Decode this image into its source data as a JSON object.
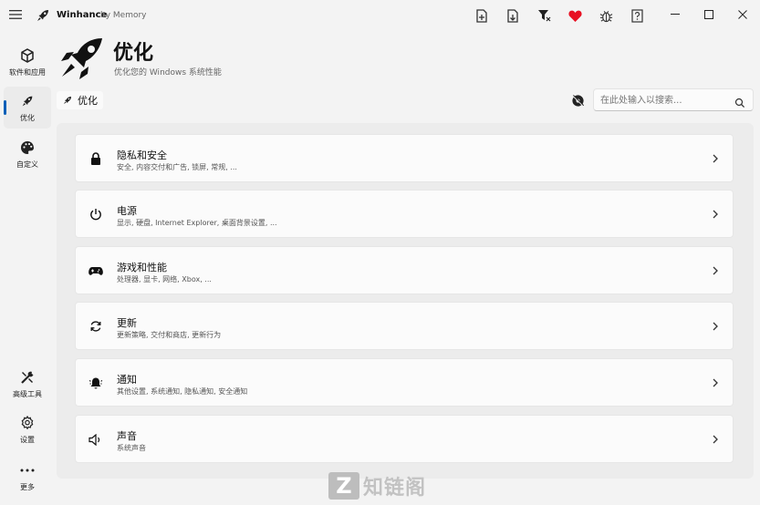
{
  "app": {
    "name": "Winhance",
    "subtitle": "by Memory"
  },
  "sidebar": {
    "items": [
      {
        "label": "软件和应用",
        "icon": "package-icon"
      },
      {
        "label": "优化",
        "icon": "rocket-icon",
        "active": true
      },
      {
        "label": "自定义",
        "icon": "palette-icon"
      },
      {
        "label": "高级工具",
        "icon": "tools-icon"
      },
      {
        "label": "设置",
        "icon": "gear-icon"
      },
      {
        "label": "更多",
        "icon": "more-icon"
      }
    ]
  },
  "header": {
    "title": "优化",
    "subtitle": "优化您的 Windows 系统性能"
  },
  "breadcrumb": {
    "label": "优化"
  },
  "search": {
    "placeholder": "在此处输入以搜索..."
  },
  "cards": [
    {
      "title": "隐私和安全",
      "desc": "安全, 内容交付和广告, 锁屏, 常规, ...",
      "icon": "lock-icon"
    },
    {
      "title": "电源",
      "desc": "显示, 硬盘, Internet Explorer, 桌面背景设置, ...",
      "icon": "power-icon"
    },
    {
      "title": "游戏和性能",
      "desc": "处理器, 显卡, 网络, Xbox, ...",
      "icon": "gamepad-icon"
    },
    {
      "title": "更新",
      "desc": "更新策略, 交付和商店, 更新行为",
      "icon": "refresh-icon"
    },
    {
      "title": "通知",
      "desc": "其他设置, 系统通知, 隐私通知, 安全通知",
      "icon": "bell-icon"
    },
    {
      "title": "声音",
      "desc": "系统声音",
      "icon": "speaker-icon"
    }
  ],
  "watermark": {
    "letter": "Z",
    "text": "知链阁"
  },
  "colors": {
    "accent": "#005fb8",
    "heart": "#e81123",
    "background": "#f3f3f3",
    "card": "#fbfbfb"
  }
}
